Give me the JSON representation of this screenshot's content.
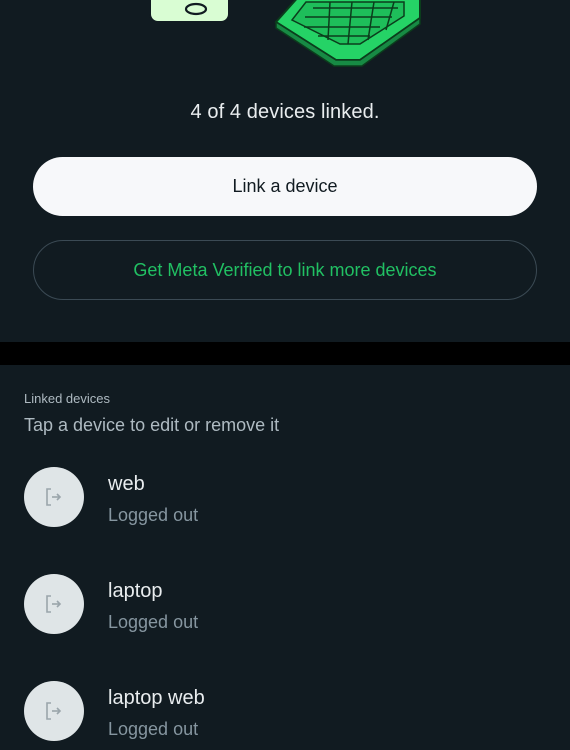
{
  "status": {
    "text": "4 of 4 devices linked."
  },
  "buttons": {
    "link_device": "Link a device",
    "meta_verified": "Get Meta Verified to link more devices"
  },
  "linked_devices": {
    "label": "Linked devices",
    "hint": "Tap a device to edit or remove it",
    "items": [
      {
        "name": "web",
        "status": "Logged out",
        "icon": "logout-icon"
      },
      {
        "name": "laptop",
        "status": "Logged out",
        "icon": "logout-icon"
      },
      {
        "name": "laptop web",
        "status": "Logged out",
        "icon": "logout-icon"
      }
    ]
  },
  "colors": {
    "background": "#111b21",
    "accent_green": "#21c063",
    "primary_button": "#f7f8fa",
    "avatar": "#dfe5e7"
  }
}
